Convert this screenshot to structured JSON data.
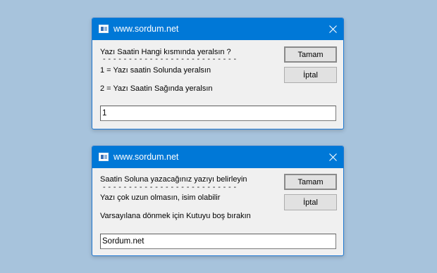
{
  "dialogs": [
    {
      "title": "www.sordum.net",
      "lines": [
        "Yazı Saatin Hangi kısmında yeralsın ?",
        "- - - - - - - - - - - - - - - - - - - - - - - - - -",
        "1 = Yazı saatin Solunda yeralsın",
        "2 = Yazı Saatin Sağında yeralsın"
      ],
      "ok_label": "Tamam",
      "cancel_label": "İptal",
      "input_value": "1"
    },
    {
      "title": "www.sordum.net",
      "lines": [
        "Saatin Soluna yazacağınız yazıyı belirleyin",
        "- - - - - - - - - - - - - - - - - - - - - - - - - -",
        "Yazı çok uzun olmasın, isim olabilir",
        "Varsayılana dönmek için Kutuyu boş bırakın"
      ],
      "ok_label": "Tamam",
      "cancel_label": "İptal",
      "input_value": "Sordum.net"
    }
  ],
  "icons": {
    "app": "app-window-icon",
    "close": "close-icon"
  },
  "colors": {
    "desktop": "#a7c3dc",
    "titlebar": "#0078d7",
    "dialog_bg": "#f0f0f0"
  }
}
